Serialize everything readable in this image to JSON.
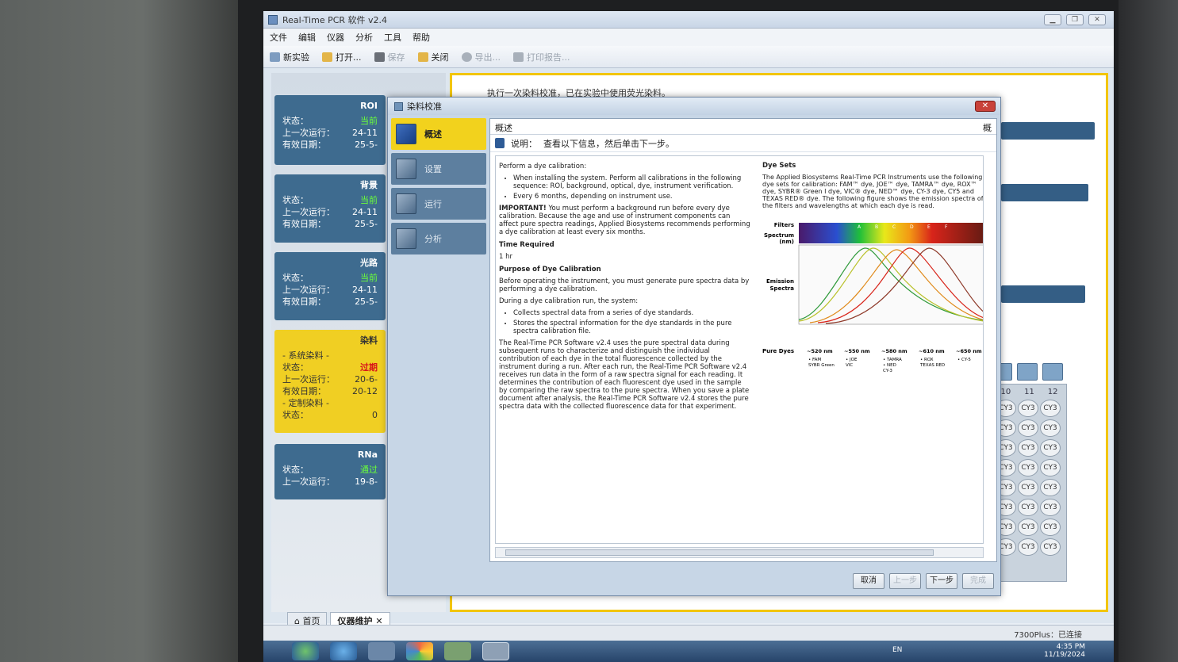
{
  "window": {
    "title": "Real-Time PCR 软件 v2.4"
  },
  "menu": [
    "文件",
    "编辑",
    "仪器",
    "分析",
    "工具",
    "帮助"
  ],
  "toolbar": {
    "new": "新实验",
    "open": "打开...",
    "save": "保存",
    "close": "关闭",
    "export": "导出...",
    "print": "打印报告..."
  },
  "left_cards": [
    {
      "title": "ROI",
      "rows": [
        [
          "状态：",
          "当前"
        ],
        [
          "上一次运行：",
          "24-11"
        ],
        [
          "有效日期：",
          "25-5-"
        ]
      ]
    },
    {
      "title": "背景",
      "rows": [
        [
          "状态：",
          "当前"
        ],
        [
          "上一次运行：",
          "24-11"
        ],
        [
          "有效日期：",
          "25-5-"
        ]
      ]
    },
    {
      "title": "光路",
      "rows": [
        [
          "状态：",
          "当前"
        ],
        [
          "上一次运行：",
          "24-11"
        ],
        [
          "有效日期：",
          "25-5-"
        ]
      ]
    },
    {
      "title": "染料",
      "sub1": "- 系统染料 -",
      "rows": [
        [
          "状态：",
          "过期"
        ],
        [
          "上一次运行：",
          "20-6-"
        ],
        [
          "有效日期：",
          "20-12"
        ]
      ],
      "sub2": "- 定制染料 -",
      "custom_status": [
        "状态：",
        "0"
      ]
    },
    {
      "title": "RNa",
      "rows": [
        [
          "状态：",
          "通过"
        ],
        [
          "上一次运行：",
          "19-8-"
        ]
      ]
    }
  ],
  "main": {
    "instruction": "执行一次染料校准，已在实验中使用荧光染料。"
  },
  "plate": {
    "cols": [
      "10",
      "11",
      "12"
    ],
    "well_label": "CY3",
    "rows": 8
  },
  "dialog": {
    "title": "染料校准",
    "close": "✕",
    "steps": [
      "概述",
      "设置",
      "运行",
      "分析"
    ],
    "header": "概述",
    "header_cut": "概",
    "note_label": "说明：",
    "note_text": "查看以下信息，然后单击下一步。",
    "doc": {
      "intro": "Perform a dye calibration:",
      "bullets1": [
        "When installing the system. Perform all calibrations in the following sequence: ROI, background, optical, dye, instrument verification.",
        "Every 6 months, depending on instrument use."
      ],
      "important_label": "IMPORTANT!",
      "important_text": " You must perform a background run before every dye calibration. Because the age and use of instrument components can affect pure spectra readings, Applied Biosystems recommends performing a dye calibration at least every six months.",
      "time_heading": "Time Required",
      "time_value": "1 hr",
      "purpose_heading": "Purpose of Dye Calibration",
      "purpose_text": "Before operating the instrument, you must generate pure spectra data by performing a dye calibration.",
      "during_text": "During a dye calibration run, the system:",
      "bullets2": [
        "Collects spectral data from a series of dye standards.",
        "Stores the spectral information for the dye standards in the pure spectra calibration file."
      ],
      "final_text": "The Real-Time PCR Software v2.4 uses the pure spectral data during subsequent runs to characterize and distinguish the individual contribution of each dye in the total fluorescence collected by the instrument during a run. After each run, the Real-Time PCR Software v2.4 receives run data in the form of a raw spectra signal for each reading. It determines the contribution of each fluorescent dye used in the sample by comparing the raw spectra to the pure spectra. When you save a plate document after analysis, the Real-Time PCR Software v2.4 stores the pure spectra data with the collected fluorescence data for that experiment.",
      "dyesets_heading": "Dye Sets",
      "dyesets_text": "The Applied Biosystems Real-Time PCR Instruments use the following dye sets for calibration: FAM™ dye, JOE™ dye, TAMRA™ dye, ROX™ dye, SYBR® Green I dye, VIC® dye, NED™ dye, CY-3 dye, CY5 and TEXAS RED® dye. The following figure shows the emission spectra of the filters and wavelengths at which each dye is read.",
      "fig_labels": {
        "filters": "Filters",
        "spectrum": "Spectrum",
        "nm": "(nm)",
        "emission": "Emission",
        "spectra": "Spectra",
        "pure_dyes": "Pure Dyes",
        "filter_letters": [
          "A",
          "B",
          "C",
          "D",
          "E",
          "F"
        ]
      },
      "pure_dyes": [
        {
          "nm": "~520 nm",
          "dyes": "• FAM\nSYBR Green"
        },
        {
          "nm": "~550 nm",
          "dyes": "• JOE\nVIC"
        },
        {
          "nm": "~580 nm",
          "dyes": "• TAMRA\n• NED\nCY-3"
        },
        {
          "nm": "~610 nm",
          "dyes": "• ROX\nTEXAS RED"
        },
        {
          "nm": "~650 nm",
          "dyes": "• CY-5"
        }
      ]
    },
    "buttons": {
      "cancel": "取消",
      "prev": "上一步",
      "next": "下一步",
      "finish": "完成"
    }
  },
  "tabs": [
    "首页",
    "仪器维护"
  ],
  "status": {
    "connection": "7300Plus：已连接"
  },
  "tray": {
    "lang": "EN",
    "time": "4:35 PM",
    "date": "11/19/2024"
  },
  "colors": {
    "accent_yellow": "#f2c500",
    "card_blue": "#3e6b8f",
    "status_ok": "#6bff3a",
    "status_bad": "#d8141a"
  }
}
